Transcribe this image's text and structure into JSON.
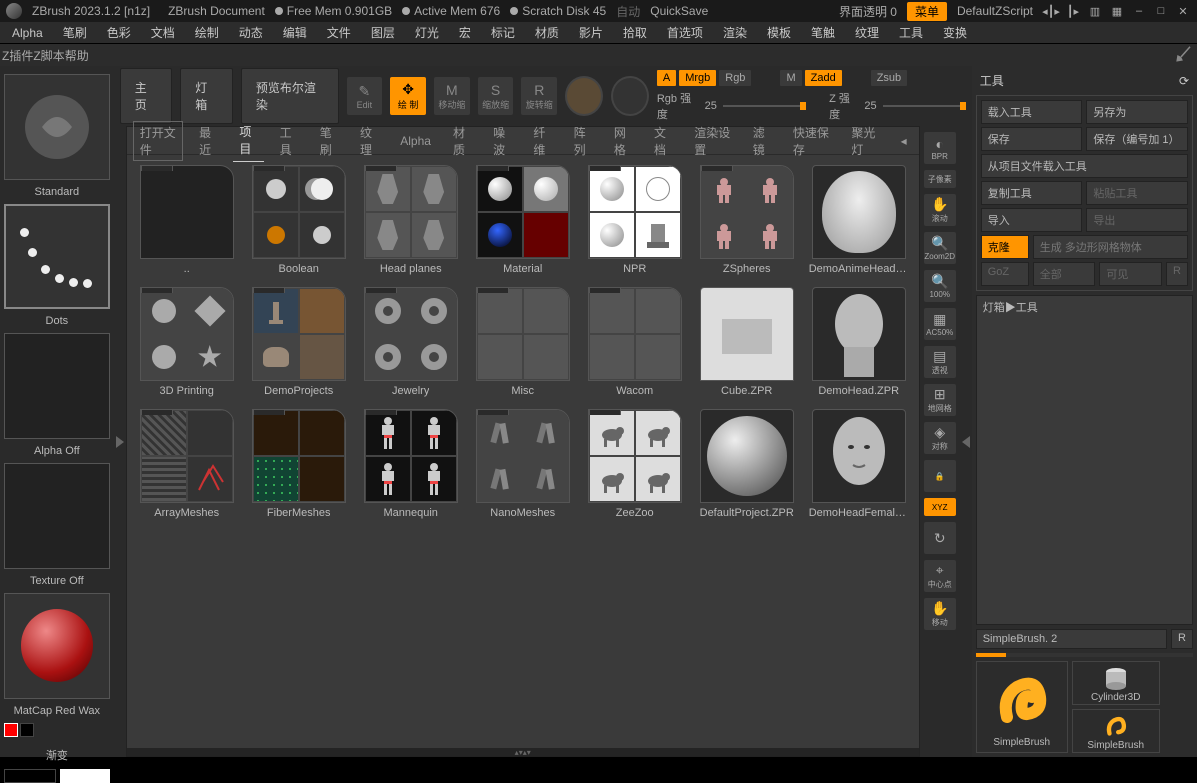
{
  "titlebar": {
    "version": "ZBrush 2023.1.2 [n1z]",
    "document": "ZBrush Document",
    "freemem_label": "Free Mem 0.901GB",
    "activemem_label": "Active Mem 676",
    "scratch_label": "Scratch Disk 45",
    "auto": "自动",
    "quicksave": "QuickSave",
    "transparency": "界面透明 0",
    "menu_btn": "菜单",
    "script": "DefaultZScript"
  },
  "menus": [
    "Alpha",
    "笔刷",
    "色彩",
    "文档",
    "绘制",
    "动态",
    "编辑",
    "文件",
    "图层",
    "灯光",
    "宏",
    "标记",
    "材质",
    "影片",
    "拾取",
    "首选项",
    "渲染",
    "模板",
    "笔触",
    "纹理",
    "工具",
    "变换"
  ],
  "menus2": [
    "Z插件",
    "Z脚本",
    "帮助"
  ],
  "shelf": {
    "home": "主页",
    "lightbox": "灯箱",
    "preview": "预览布尔渲染",
    "edit": "Edit",
    "draw": "绘 制",
    "move": "移动缩",
    "scale": "缩放缩",
    "rotate": "旋转缩"
  },
  "modes": {
    "A": "A",
    "Mrgb": "Mrgb",
    "Rgb": "Rgb",
    "M": "M",
    "Zadd": "Zadd",
    "Zsub": "Zsub",
    "rgb_intensity_label": "Rgb 强度",
    "rgb_intensity_value": "25",
    "z_intensity_label": "Z 强度",
    "z_intensity_value": "25"
  },
  "left": {
    "brush": "Standard",
    "stroke": "Dots",
    "alpha": "Alpha Off",
    "texture": "Texture Off",
    "material": "MatCap Red Wax",
    "gradient": "渐变"
  },
  "browser": {
    "open": "打开文件",
    "tabs": [
      "最近",
      "项目",
      "工具",
      "笔刷",
      "纹理",
      "Alpha",
      "材质",
      "噪波",
      "纤维",
      "阵列",
      "网格",
      "文档",
      "渲染设置",
      "滤镜",
      "快速保存",
      "聚光灯"
    ],
    "active_tab": "项目",
    "items": [
      {
        "label": "..",
        "type": "up"
      },
      {
        "label": "Boolean",
        "type": "folder",
        "preview": "boolean"
      },
      {
        "label": "Head planes",
        "type": "folder",
        "preview": "planes"
      },
      {
        "label": "Material",
        "type": "folder",
        "preview": "material"
      },
      {
        "label": "NPR",
        "type": "folder",
        "preview": "npr"
      },
      {
        "label": "ZSpheres",
        "type": "folder",
        "preview": "zspheres"
      },
      {
        "label": "DemoAnimeHead.ZPR",
        "type": "file",
        "preview": "animehead"
      },
      {
        "label": "3D Printing",
        "type": "folder",
        "preview": "3dprint"
      },
      {
        "label": "DemoProjects",
        "type": "folder",
        "preview": "demos"
      },
      {
        "label": "Jewelry",
        "type": "folder",
        "preview": "jewelry"
      },
      {
        "label": "Misc",
        "type": "folder",
        "preview": "misc"
      },
      {
        "label": "Wacom",
        "type": "folder",
        "preview": "wacom"
      },
      {
        "label": "Cube.ZPR",
        "type": "file",
        "preview": "cube"
      },
      {
        "label": "DemoHead.ZPR",
        "type": "file",
        "preview": "demohead"
      },
      {
        "label": "ArrayMeshes",
        "type": "folder",
        "preview": "array"
      },
      {
        "label": "FiberMeshes",
        "type": "folder",
        "preview": "fiber"
      },
      {
        "label": "Mannequin",
        "type": "folder",
        "preview": "mannequin"
      },
      {
        "label": "NanoMeshes",
        "type": "folder",
        "preview": "nano"
      },
      {
        "label": "ZeeZoo",
        "type": "folder",
        "preview": "zeezoo"
      },
      {
        "label": "DefaultProject.ZPR",
        "type": "file",
        "preview": "sphere"
      },
      {
        "label": "DemoHeadFemale.ZPR",
        "type": "file",
        "preview": "femalehead"
      }
    ]
  },
  "strip": {
    "bpr": "BPR",
    "sub": "子像素",
    "scroll": "滚动",
    "zoom2d": "Zoom2D",
    "p100": "100%",
    "ac50": "AC50%",
    "persp": "透视",
    "floor": "地网格",
    "sym": "对称",
    "lock": "🔒",
    "xyz": "XYZ",
    "center": "中心点",
    "move": "移动"
  },
  "panel": {
    "title": "工具",
    "load": "载入工具",
    "saveas": "另存为",
    "save": "保存",
    "savenum": "保存（编号加 1）",
    "importproj": "从项目文件载入工具",
    "copy": "复制工具",
    "paste": "粘贴工具",
    "import": "导入",
    "export": "导出",
    "clone": "克隆",
    "genpoly": "生成 多边形网格物体",
    "goz": "GoZ",
    "all": "全部",
    "visible": "可见",
    "R": "R",
    "lightbox_tools": "灯箱▶工具",
    "current": "SimpleBrush. 2",
    "R2": "R",
    "tools": [
      {
        "name": "SimpleBrush"
      },
      {
        "name": "Cylinder3D"
      },
      {
        "name": "SimpleBrush"
      }
    ]
  }
}
